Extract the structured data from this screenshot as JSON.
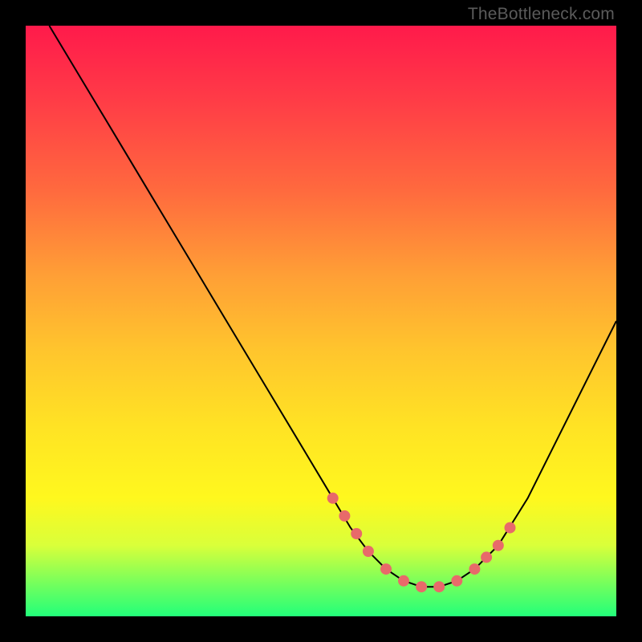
{
  "watermark": "TheBottleneck.com",
  "colors": {
    "background": "#000000",
    "marker": "#e86a6a",
    "curve": "#000000"
  },
  "chart_data": {
    "type": "line",
    "title": "",
    "xlabel": "",
    "ylabel": "",
    "xlim": [
      0,
      100
    ],
    "ylim": [
      0,
      100
    ],
    "grid": false,
    "legend": false,
    "series": [
      {
        "name": "bottleneck-curve",
        "x": [
          4,
          10,
          16,
          22,
          28,
          34,
          40,
          46,
          52,
          55,
          58,
          61,
          64,
          67,
          70,
          73,
          76,
          80,
          85,
          90,
          95,
          100
        ],
        "values": [
          100,
          90,
          80,
          70,
          60,
          50,
          40,
          30,
          20,
          15,
          11,
          8,
          6,
          5,
          5,
          6,
          8,
          12,
          20,
          30,
          40,
          50
        ]
      }
    ],
    "markers": {
      "name": "highlighted-points",
      "x": [
        52,
        54,
        56,
        58,
        61,
        64,
        67,
        70,
        73,
        76,
        78,
        80,
        82
      ],
      "values": [
        20,
        17,
        14,
        11,
        8,
        6,
        5,
        5,
        6,
        8,
        10,
        12,
        15
      ]
    }
  }
}
